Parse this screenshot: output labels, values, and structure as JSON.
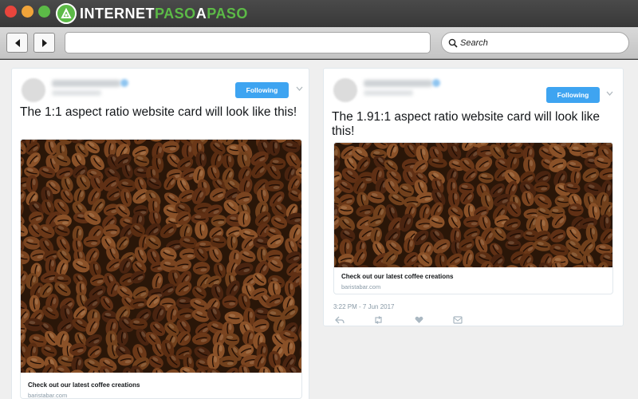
{
  "window": {
    "logo": {
      "part1": "INTERNET",
      "part2": "PASO",
      "part3": "A",
      "part4": "PASO"
    }
  },
  "toolbar": {
    "back_icon": "back-arrow-icon",
    "forward_icon": "forward-arrow-icon",
    "url_value": "",
    "search_label": "Search"
  },
  "cards": [
    {
      "follow_label": "Following",
      "text": "The 1:1 aspect ratio website card will look like this!",
      "link_title": "Check out our latest coffee creations",
      "link_domain": "baristabar.com"
    },
    {
      "follow_label": "Following",
      "text": "The 1.91:1 aspect ratio website card will look like this!",
      "link_title": "Check out our latest coffee creations",
      "link_domain": "baristabar.com",
      "timestamp": "3:22 PM - 7 Jun 2017",
      "actions": [
        "reply-icon",
        "retweet-icon",
        "like-icon",
        "dm-icon"
      ]
    }
  ],
  "colors": {
    "follow_blue": "#3ea4f1",
    "coffee_background": "#2a1608"
  }
}
